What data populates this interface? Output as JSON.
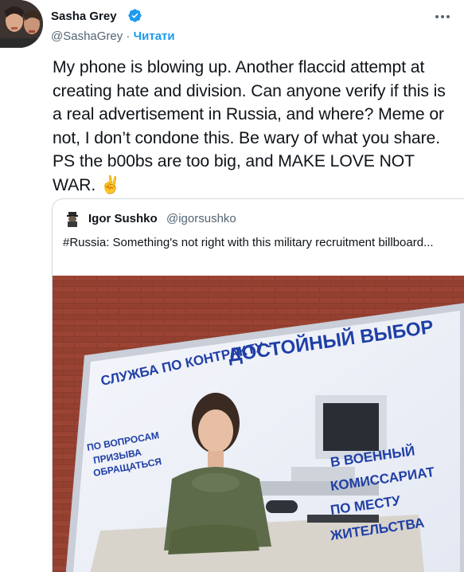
{
  "author": {
    "name": "Sasha Grey",
    "handle": "@SashaGrey",
    "separator": " · ",
    "follow_label": "Читати"
  },
  "tweet": {
    "text": "My phone is blowing up. Another flaccid attempt at creating hate and division. Can anyone verify if this is a real advertisement in Russia, and where? Meme or not, I don’t condone this. Be wary of what you share. PS the b00bs are too big, and MAKE LOVE NOT WAR. ✌️"
  },
  "quoted": {
    "name": "Igor Sushko",
    "handle": "@igorsushko",
    "text": "#Russia: Something's not right with this military recruitment billboard...",
    "billboard": {
      "headline_1": "СЛУЖБА ПО КОНТРАКТУ -",
      "headline_2": "ДОСТОЙНЫЙ ВЫБОР",
      "left_1": "ПО ВОПРОСАМ",
      "left_2": "ПРИЗЫВА",
      "left_3": "ОБРАЩАТЬСЯ",
      "right_1": "В ВОЕННЫЙ",
      "right_2": "КОМИССАРИАТ",
      "right_3": "ПО МЕСТУ",
      "right_4": "ЖИТЕЛЬСТВА"
    }
  },
  "colors": {
    "accent": "#1d9bf0",
    "text": "#0f1419",
    "secondary": "#536471",
    "border": "#cfd9de",
    "billboard_text": "#1f3fa6",
    "brick": "#8a3a2c"
  },
  "icons": {
    "verified": "verified-badge-icon",
    "more": "more-options-icon"
  }
}
